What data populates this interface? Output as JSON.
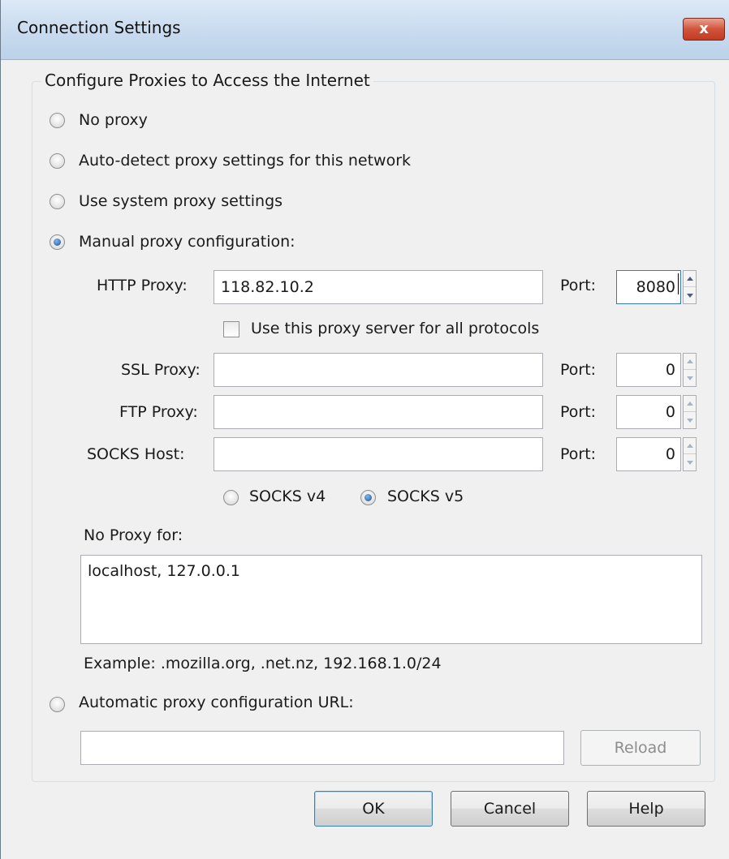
{
  "window": {
    "title": "Connection Settings",
    "close_label": "x"
  },
  "group": {
    "legend": "Configure Proxies to Access the Internet"
  },
  "options": {
    "no_proxy": "No proxy",
    "auto_detect": "Auto-detect proxy settings for this network",
    "system": "Use system proxy settings",
    "manual": "Manual proxy configuration:",
    "auto_url": "Automatic proxy configuration URL:"
  },
  "manual": {
    "http_label": "HTTP Proxy:",
    "http_value": "118.82.10.2",
    "http_port_label": "Port:",
    "http_port": "8080",
    "use_all_label": "Use this proxy server for all protocols",
    "ssl_label": "SSL Proxy:",
    "ssl_value": "",
    "ssl_port_label": "Port:",
    "ssl_port": "0",
    "ftp_label": "FTP Proxy:",
    "ftp_value": "",
    "ftp_port_label": "Port:",
    "ftp_port": "0",
    "socks_label": "SOCKS Host:",
    "socks_value": "",
    "socks_port_label": "Port:",
    "socks_port": "0",
    "socks_v4": "SOCKS v4",
    "socks_v5": "SOCKS v5"
  },
  "no_proxy_for": {
    "label": "No Proxy for:",
    "value": "localhost, 127.0.0.1",
    "example": "Example: .mozilla.org, .net.nz, 192.168.1.0/24"
  },
  "auto_config": {
    "url_value": "",
    "reload_label": "Reload"
  },
  "buttons": {
    "ok": "OK",
    "cancel": "Cancel",
    "help": "Help"
  },
  "selected_mode": "manual",
  "selected_socks": "v5",
  "use_all_checked": false,
  "colors": {
    "titlebar": "#c6d9ee",
    "close": "#c23b22",
    "dialog_bg": "#f0f0f0",
    "focus_border": "#3d7bad"
  }
}
